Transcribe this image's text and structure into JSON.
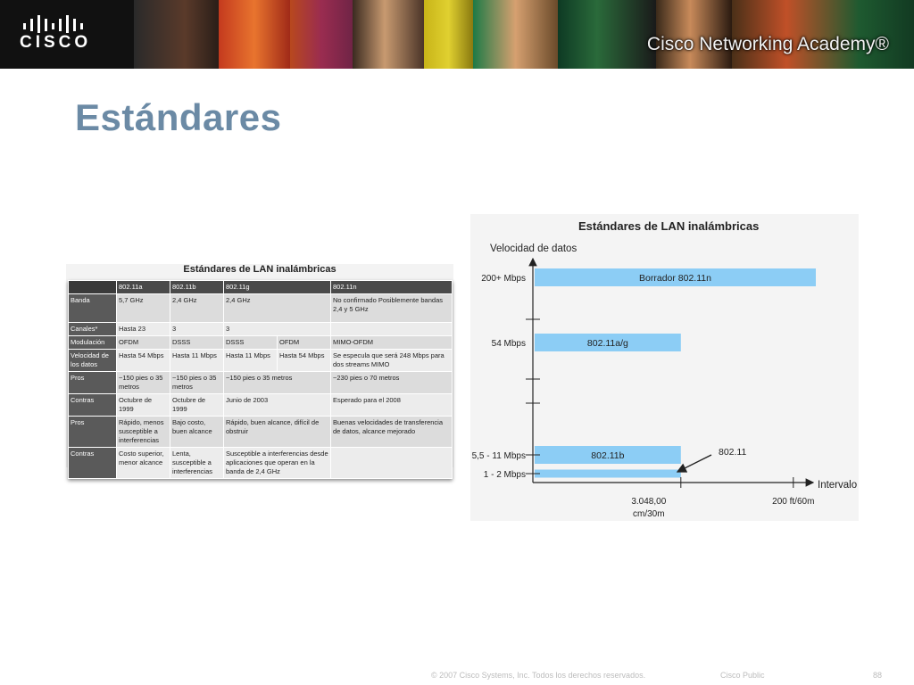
{
  "header": {
    "logo_text": "CISCO",
    "academy_title": "Cisco Networking Academy®"
  },
  "slide": {
    "title": "Estándares"
  },
  "table": {
    "title": "Estándares de LAN inalámbricas",
    "columns": [
      "",
      "802.11a",
      "802.11b",
      "802.11g",
      "",
      "802.11n"
    ],
    "rows": [
      {
        "label": "Banda",
        "cells": [
          "5,7 GHz",
          "2,4 GHz",
          "2,4 GHz",
          "",
          "No confirmado Posiblemente bandas 2,4 y 5 GHz"
        ]
      },
      {
        "label": "Canales*",
        "cells": [
          "Hasta 23",
          "3",
          "3",
          "",
          ""
        ]
      },
      {
        "label": "Modulación",
        "cells": [
          "OFDM",
          "DSSS",
          "DSSS",
          "OFDM",
          "MIMO-OFDM"
        ]
      },
      {
        "label": "Velocidad de los datos",
        "cells": [
          "Hasta 54 Mbps",
          "Hasta 11 Mbps",
          "Hasta 11 Mbps",
          "Hasta 54 Mbps",
          "Se especula que será 248 Mbps para dos streams MIMO"
        ]
      },
      {
        "label": "Pros",
        "cells": [
          "~150 pies o 35 metros",
          "~150 pies o 35 metros",
          "~150 pies o 35 metros",
          "",
          "~230 pies o 70 metros"
        ]
      },
      {
        "label": "Contras",
        "cells": [
          "Octubre de 1999",
          "Octubre de 1999",
          "Junio de 2003",
          "",
          "Esperado para el 2008"
        ]
      },
      {
        "label": "Pros",
        "cells": [
          "Rápido, menos susceptible a interferencias",
          "Bajo costo, buen alcance",
          "Rápido, buen alcance, difícil de obstruir",
          "",
          "Buenas velocidades de transferencia de datos, alcance mejorado"
        ]
      },
      {
        "label": "Contras",
        "cells": [
          "Costo superior, menor alcance",
          "Lenta, susceptible a interferencias",
          "Susceptible a interferencias desde aplicaciones que operan en la banda de 2,4 GHz",
          "",
          ""
        ]
      }
    ]
  },
  "chart_data": {
    "type": "bar",
    "orientation": "horizontal",
    "title": "Estándares de LAN inalámbricas",
    "ylabel": "Velocidad de datos",
    "xlabel": "Intervalo",
    "y_ticks": [
      "200+ Mbps",
      "54 Mbps",
      "5,5 - 11 Mbps",
      "1 - 2 Mbps"
    ],
    "x_ticks": [
      "3.048,00 cm/30m",
      "200 ft/60m"
    ],
    "bars": [
      {
        "label": "Borrador 802.11n",
        "speed": "200+ Mbps",
        "range_end": 2.5
      },
      {
        "label": "802.11a/g",
        "speed": "54 Mbps",
        "range_end": 1.3
      },
      {
        "label": "802.11b",
        "speed": "5,5 - 11 Mbps",
        "range_end": 1.3
      },
      {
        "label": "",
        "speed": "1 - 2 Mbps",
        "range_end": 1.3
      }
    ],
    "annotation": "802.11",
    "bar_color": "#8ccdf5"
  },
  "footer": {
    "copyright": "© 2007 Cisco Systems, Inc. Todos los derechos reservados.",
    "classification": "Cisco Public",
    "page_number": "88"
  }
}
